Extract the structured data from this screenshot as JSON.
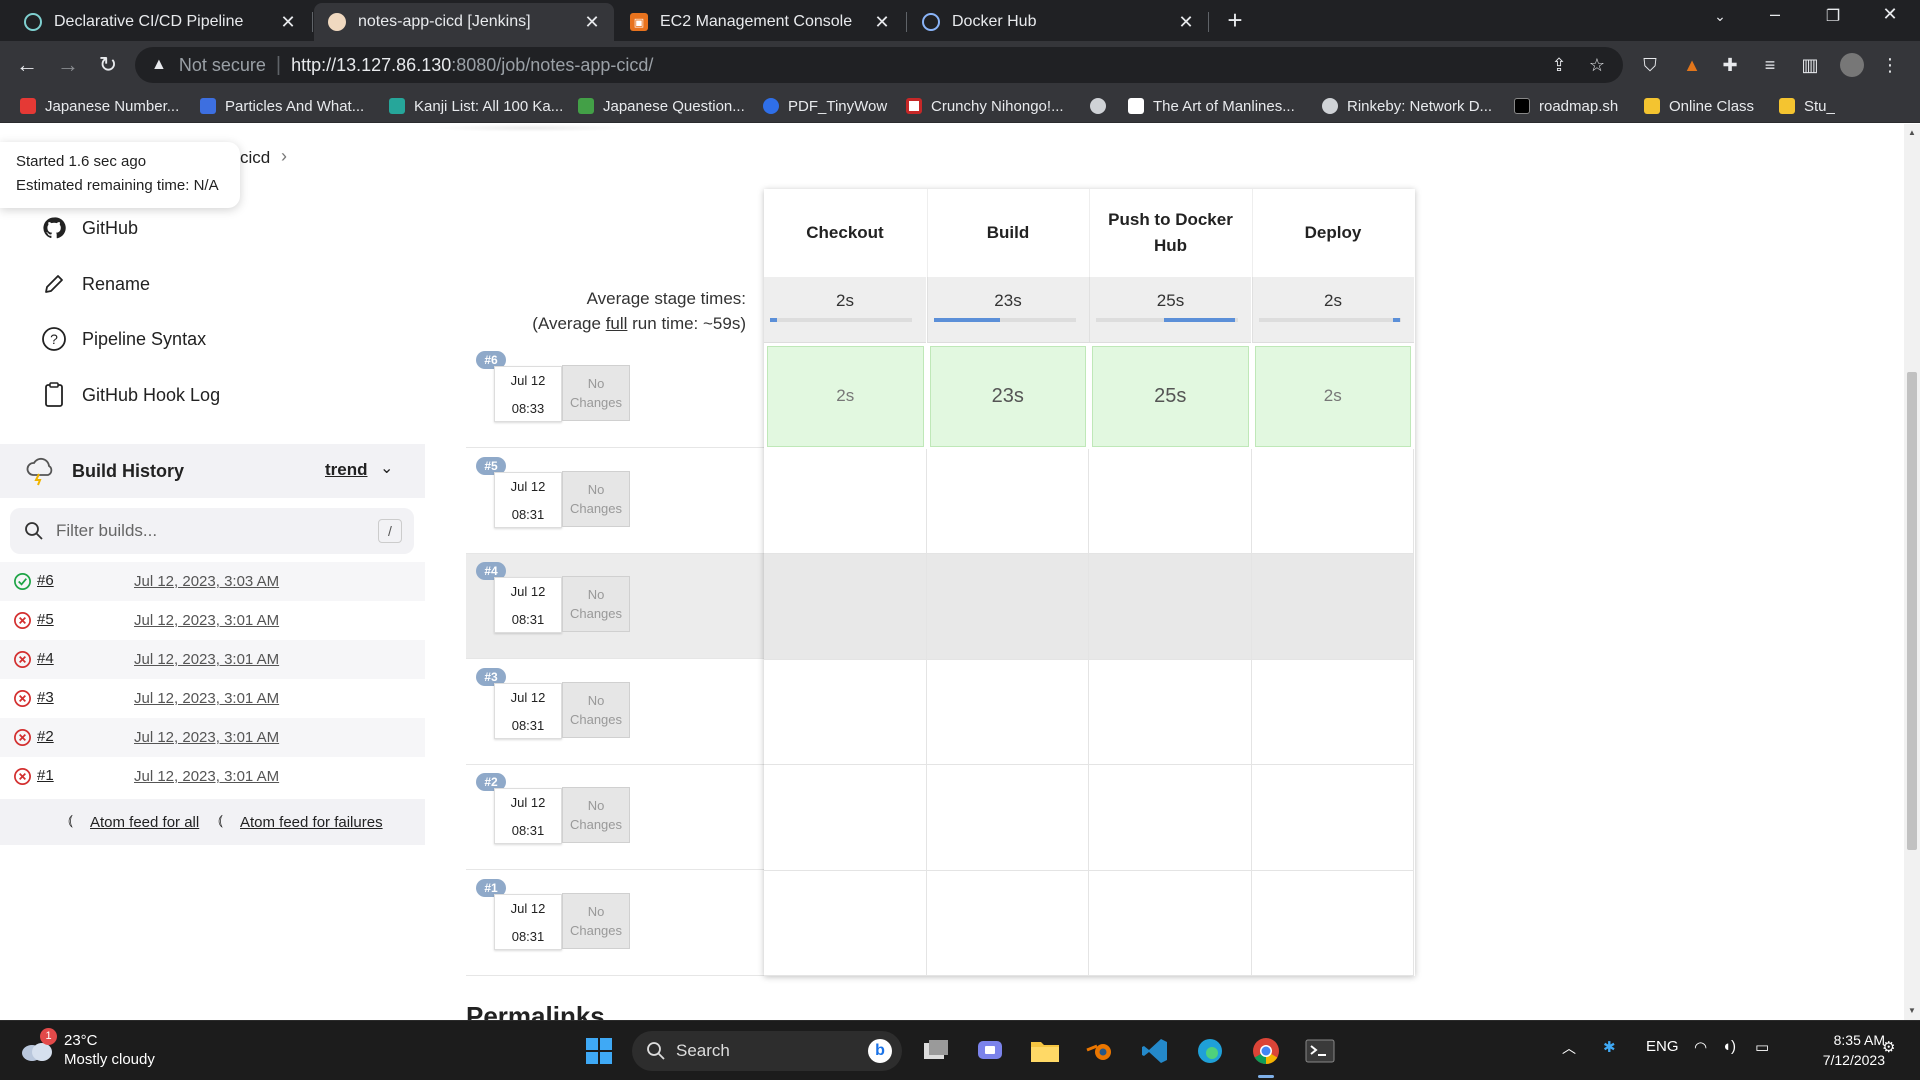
{
  "browser": {
    "tabs": [
      {
        "title": "Declarative CI/CD Pipeline",
        "active": false,
        "icon": "generic-doc-icon"
      },
      {
        "title": "notes-app-cicd [Jenkins]",
        "active": true,
        "icon": "jenkins-icon"
      },
      {
        "title": "EC2 Management Console",
        "active": false,
        "icon": "aws-icon"
      },
      {
        "title": "Docker Hub",
        "active": false,
        "icon": "docker-icon"
      }
    ],
    "omnibox": {
      "security_label": "Not secure",
      "url_host": "http://13.127.86.130",
      "url_rest": ":8080/job/notes-app-cicd/"
    },
    "bookmarks": [
      {
        "label": "Japanese Number...",
        "color": "#e53935"
      },
      {
        "label": "Particles And What...",
        "color": "#3d6fe0"
      },
      {
        "label": "Kanji List: All 100 Ka...",
        "color": "#26a69a"
      },
      {
        "label": "Japanese Question...",
        "color": "#43a047"
      },
      {
        "label": "PDF_TinyWow",
        "color": "#2f6fe8"
      },
      {
        "label": "Crunchy Nihongo!...",
        "color": "#ffffff"
      },
      {
        "label": "",
        "color": "#cfd2d6"
      },
      {
        "label": "The Art of Manlines...",
        "color": "#ffffff"
      },
      {
        "label": "Rinkeby: Network D...",
        "color": "#cfd2d6"
      },
      {
        "label": "roadmap.sh",
        "color": "#000000"
      },
      {
        "label": "Online Class",
        "color": "#f4c430"
      },
      {
        "label": "Stu_",
        "color": "#f4c430"
      }
    ]
  },
  "jenkins": {
    "tooltip": {
      "started": "Started 1.6 sec ago",
      "remaining": "Estimated remaining time: N/A"
    },
    "breadcrumb_tail": "cicd",
    "side_tasks": [
      {
        "label": "GitHub",
        "icon": "github-icon"
      },
      {
        "label": "Rename",
        "icon": "pencil-icon"
      },
      {
        "label": "Pipeline Syntax",
        "icon": "help-circle-icon"
      },
      {
        "label": "GitHub Hook Log",
        "icon": "clipboard-icon"
      }
    ],
    "build_history": {
      "title": "Build History",
      "trend_label": "trend",
      "filter_placeholder": "Filter builds...",
      "filter_shortcut": "/",
      "builds": [
        {
          "number": "#6",
          "date": "Jul 12, 2023, 3:03 AM",
          "status": "success"
        },
        {
          "number": "#5",
          "date": "Jul 12, 2023, 3:01 AM",
          "status": "failed"
        },
        {
          "number": "#4",
          "date": "Jul 12, 2023, 3:01 AM",
          "status": "failed"
        },
        {
          "number": "#3",
          "date": "Jul 12, 2023, 3:01 AM",
          "status": "failed"
        },
        {
          "number": "#2",
          "date": "Jul 12, 2023, 3:01 AM",
          "status": "failed"
        },
        {
          "number": "#1",
          "date": "Jul 12, 2023, 3:01 AM",
          "status": "failed"
        }
      ],
      "feeds": {
        "all": "Atom feed for all",
        "failures": "Atom feed for failures"
      }
    },
    "stage_view": {
      "avg_label": "Average stage times:",
      "avg_full_prefix": "(Average ",
      "avg_full_link": "full",
      "avg_full_suffix": " run time: ~59s)",
      "stages": [
        {
          "name": "Checkout",
          "avg": "2s",
          "bar_start": 0.0,
          "bar_end": 0.05
        },
        {
          "name": "Build",
          "avg": "23s",
          "bar_start": 0.0,
          "bar_end": 0.47
        },
        {
          "name": "Push to Docker Hub",
          "avg": "25s",
          "bar_start": 0.48,
          "bar_end": 0.98
        },
        {
          "name": "Deploy",
          "avg": "2s",
          "bar_start": 0.95,
          "bar_end": 1.0
        }
      ],
      "runs": [
        {
          "badge": "#6",
          "month_day": "Jul 12",
          "time": "08:33",
          "changes": "No Changes",
          "stage_times": [
            "2s",
            "23s",
            "25s",
            "2s"
          ]
        },
        {
          "badge": "#5",
          "month_day": "Jul 12",
          "time": "08:31",
          "changes": "No Changes",
          "stage_times": []
        },
        {
          "badge": "#4",
          "month_day": "Jul 12",
          "time": "08:31",
          "changes": "No Changes",
          "stage_times": []
        },
        {
          "badge": "#3",
          "month_day": "Jul 12",
          "time": "08:31",
          "changes": "No Changes",
          "stage_times": []
        },
        {
          "badge": "#2",
          "month_day": "Jul 12",
          "time": "08:31",
          "changes": "No Changes",
          "stage_times": []
        },
        {
          "badge": "#1",
          "month_day": "Jul 12",
          "time": "08:31",
          "changes": "No Changes",
          "stage_times": []
        }
      ]
    },
    "permalinks_heading": "Permalinks"
  },
  "taskbar": {
    "weather": {
      "temp": "23°C",
      "condition": "Mostly cloudy",
      "badge": "1"
    },
    "search_label": "Search",
    "tray": {
      "language": "ENG"
    },
    "clock": {
      "time": "8:35 AM",
      "date": "7/12/2023"
    }
  }
}
